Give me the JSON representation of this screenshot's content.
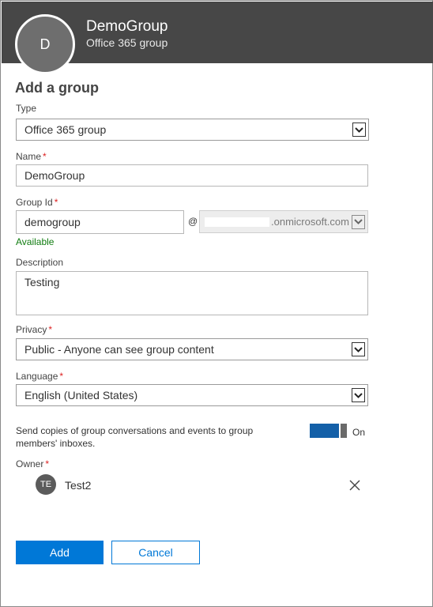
{
  "header": {
    "avatar_initial": "D",
    "title": "DemoGroup",
    "subtitle": "Office 365 group",
    "background_color": "#474747"
  },
  "form": {
    "title": "Add a group",
    "type": {
      "label": "Type",
      "value": "Office 365 group"
    },
    "name": {
      "label": "Name",
      "required_mark": "*",
      "value": "DemoGroup"
    },
    "group_id": {
      "label": "Group Id",
      "required_mark": "*",
      "value": "demogroup",
      "at_symbol": "@",
      "domain_value": ".onmicrosoft.com",
      "availability": "Available"
    },
    "description": {
      "label": "Description",
      "value": "Testing"
    },
    "privacy": {
      "label": "Privacy",
      "required_mark": "*",
      "value": "Public - Anyone can see group content"
    },
    "language": {
      "label": "Language",
      "required_mark": "*",
      "value": "English (United States)"
    },
    "send_copies": {
      "text": "Send copies of group conversations and events to group members' inboxes.",
      "state": "On",
      "toggle_color": "#1460a8"
    },
    "owner": {
      "label": "Owner",
      "required_mark": "*",
      "initials": "TE",
      "name": "Test2",
      "remove_icon": "close-icon"
    }
  },
  "actions": {
    "add_label": "Add",
    "cancel_label": "Cancel",
    "accent_color": "#0078d7"
  }
}
